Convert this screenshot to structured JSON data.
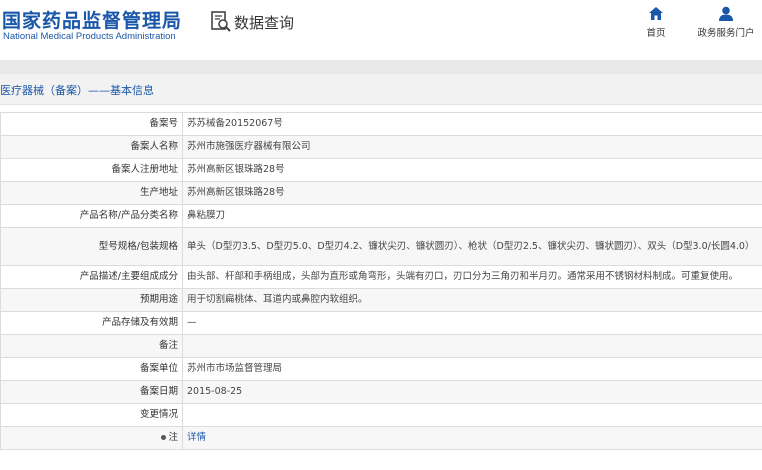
{
  "header": {
    "brand_cn": "国家药品监督管理局",
    "brand_en": "National Medical Products Administration",
    "query_title": "数据查询",
    "nav": [
      {
        "label": "首页",
        "icon": "home-icon"
      },
      {
        "label": "政务服务门户",
        "icon": "user-icon"
      }
    ],
    "brand_color": "#1a57a8"
  },
  "page_title": "医疗器械（备案）——基本信息",
  "rows": [
    {
      "label": "备案号",
      "value": "苏苏械备20152067号"
    },
    {
      "label": "备案人名称",
      "value": "苏州市施强医疗器械有限公司"
    },
    {
      "label": "备案人注册地址",
      "value": "苏州高新区银珠路28号"
    },
    {
      "label": "生产地址",
      "value": "苏州高新区银珠路28号"
    },
    {
      "label": "产品名称/产品分类名称",
      "value": "鼻粘膜刀"
    },
    {
      "label": "型号规格/包装规格",
      "value": "单头（D型刃3.5、D型刃5.0、D型刃4.2、镰状尖刃、镰状圆刃）、枪状（D型刃2.5、镰状尖刃、镰状圆刃）、双头（D型3.0/长圆4.0）"
    },
    {
      "label": "产品描述/主要组成成分",
      "value": "由头部、杆部和手柄组成，头部为直形或角弯形，头端有刃口，刃口分为三角刃和半月刃。通常采用不锈钢材料制成。可重复使用。"
    },
    {
      "label": "预期用途",
      "value": "用于切割扁桃体、耳道内或鼻腔内软组织。"
    },
    {
      "label": "产品存储及有效期",
      "value": "—"
    },
    {
      "label": "备注",
      "value": ""
    },
    {
      "label": "备案单位",
      "value": "苏州市市场监督管理局"
    },
    {
      "label": "备案日期",
      "value": "2015-08-25"
    },
    {
      "label": "变更情况",
      "value": ""
    },
    {
      "label": "注",
      "value": "详情"
    }
  ]
}
